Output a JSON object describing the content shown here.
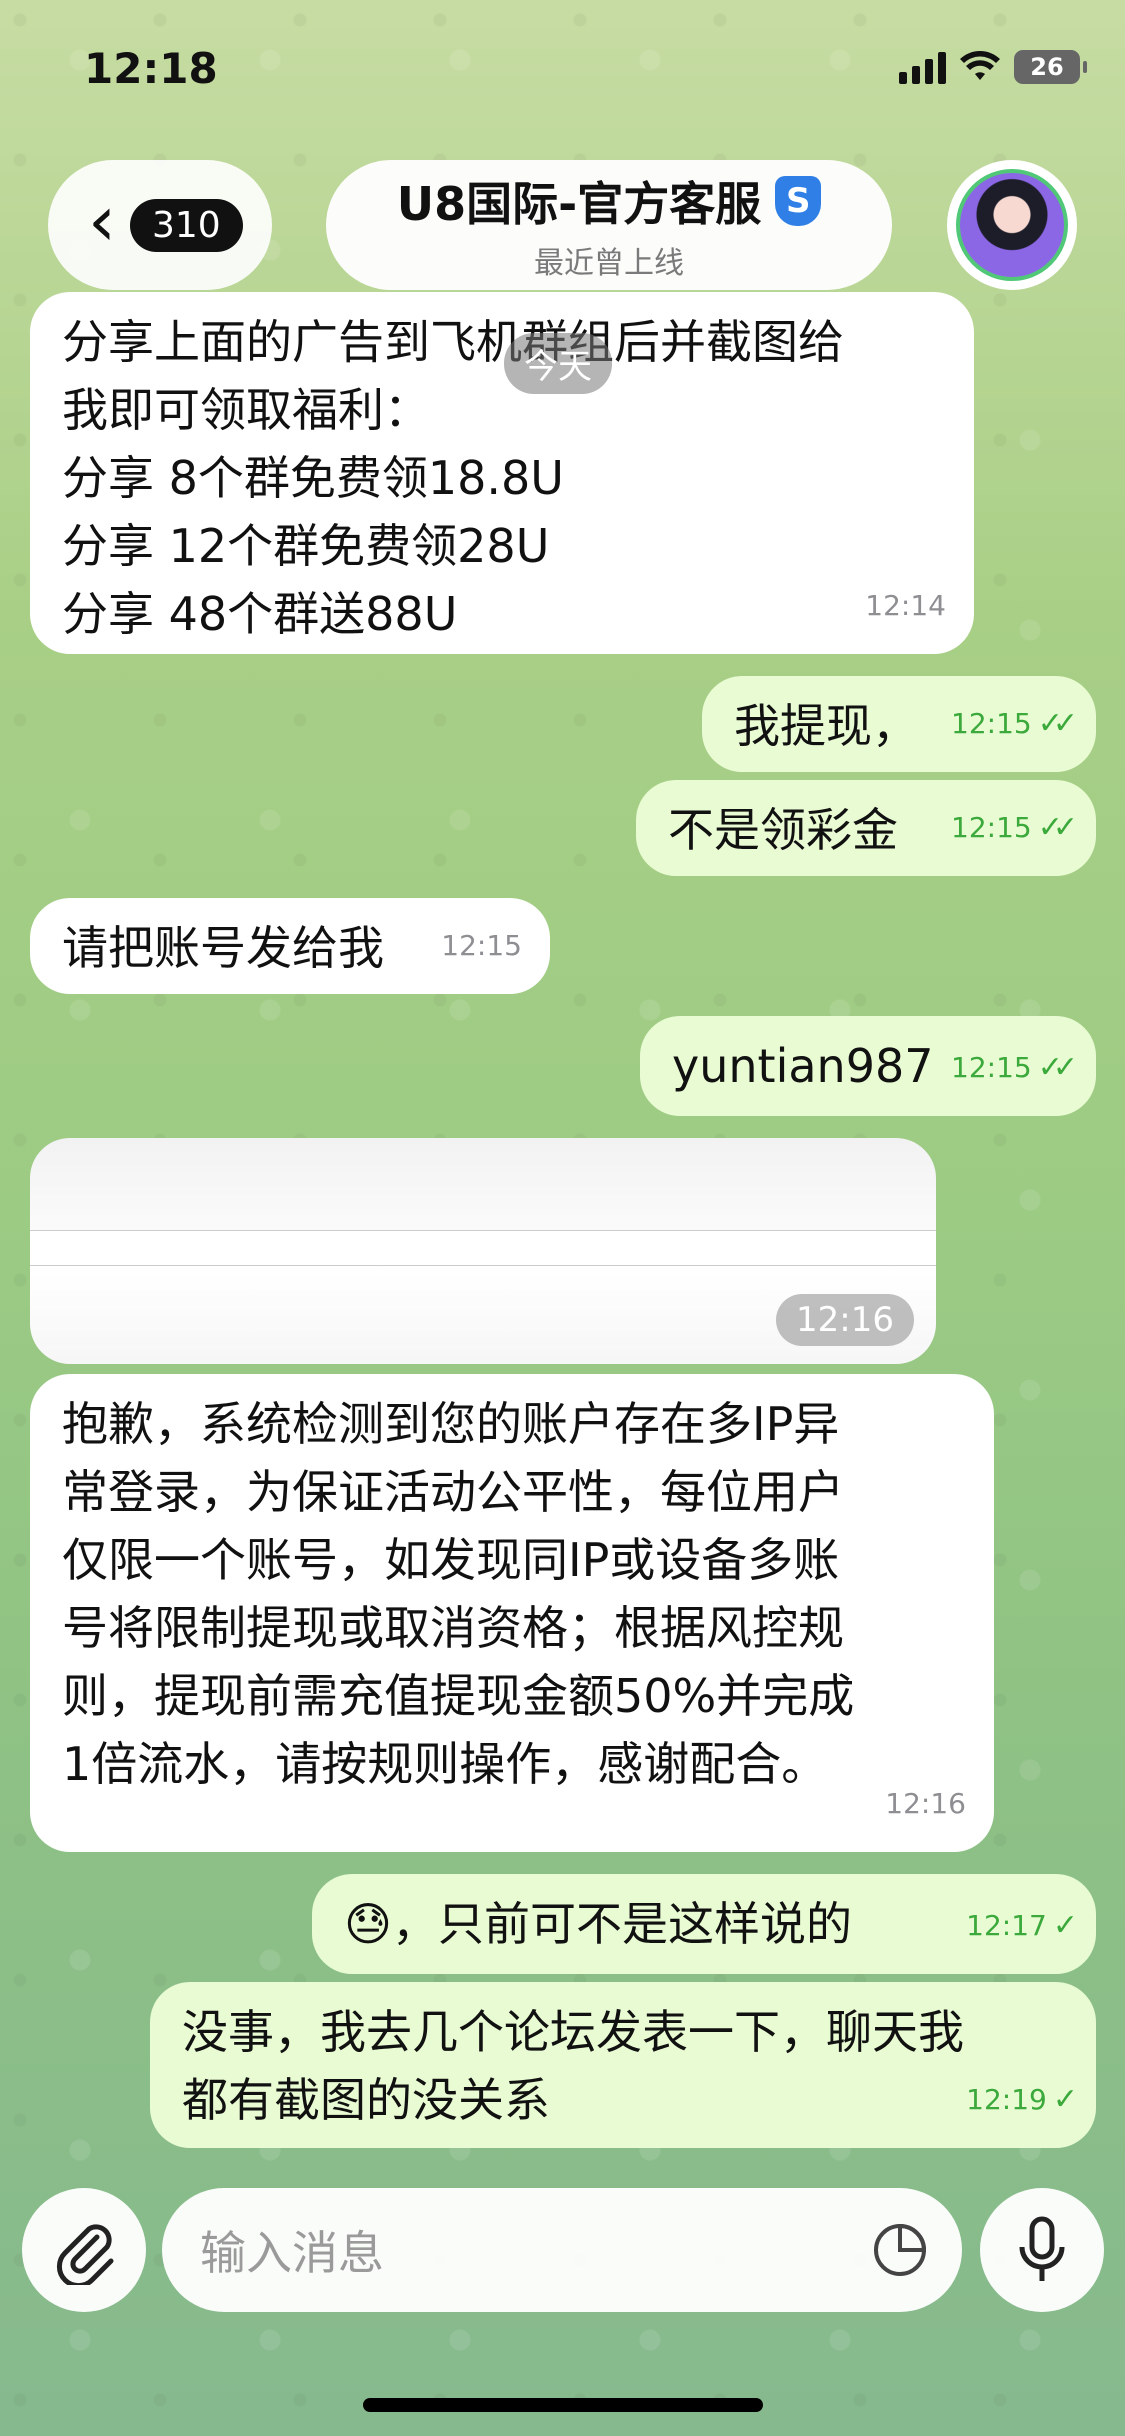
{
  "status": {
    "time": "12:18",
    "battery": "26"
  },
  "header": {
    "back_badge": "310",
    "title": "U8国际-官方客服",
    "verified_mark": "S",
    "subtitle": "最近曾上线"
  },
  "date_chip": "今天",
  "messages": [
    {
      "side": "in",
      "lines": [
        "分享上面的广告到飞机群组后并截图给",
        "我即可领取福利：",
        "分享 8个群免费领18.8U",
        "分享 12个群免费领28U",
        "分享 48个群送88U"
      ],
      "time": "12:14"
    },
    {
      "side": "out",
      "text": "我提现，",
      "time": "12:15",
      "checks": "double"
    },
    {
      "side": "out",
      "text": "不是领彩金",
      "time": "12:15",
      "checks": "double"
    },
    {
      "side": "in",
      "text": "请把账号发给我",
      "time": "12:15"
    },
    {
      "side": "out",
      "text": "yuntian987",
      "time": "12:15",
      "checks": "double"
    },
    {
      "side": "in",
      "type": "image",
      "time": "12:16"
    },
    {
      "side": "in",
      "lines": [
        "抱歉，系统检测到您的账户存在多IP异",
        "常登录，为保证活动公平性，每位用户",
        "仅限一个账号，如发现同IP或设备多账",
        "号将限制提现或取消资格；根据风控规",
        "则，提现前需充值提现金额50%并完成",
        "1倍流水，请按规则操作，感谢配合。"
      ],
      "time": "12:16"
    },
    {
      "side": "out",
      "emoji": "😓",
      "text": "，只前可不是这样说的",
      "time": "12:17",
      "checks": "single"
    },
    {
      "side": "out",
      "lines": [
        "没事，我去几个论坛发表一下，聊天我",
        "都有截图的没关系"
      ],
      "time": "12:19",
      "checks": "single"
    }
  ],
  "input": {
    "placeholder": "输入消息"
  },
  "icons": [
    "attach-icon",
    "sticker-icon",
    "microphone-icon",
    "chevron-left-icon",
    "verified-shield-icon"
  ]
}
